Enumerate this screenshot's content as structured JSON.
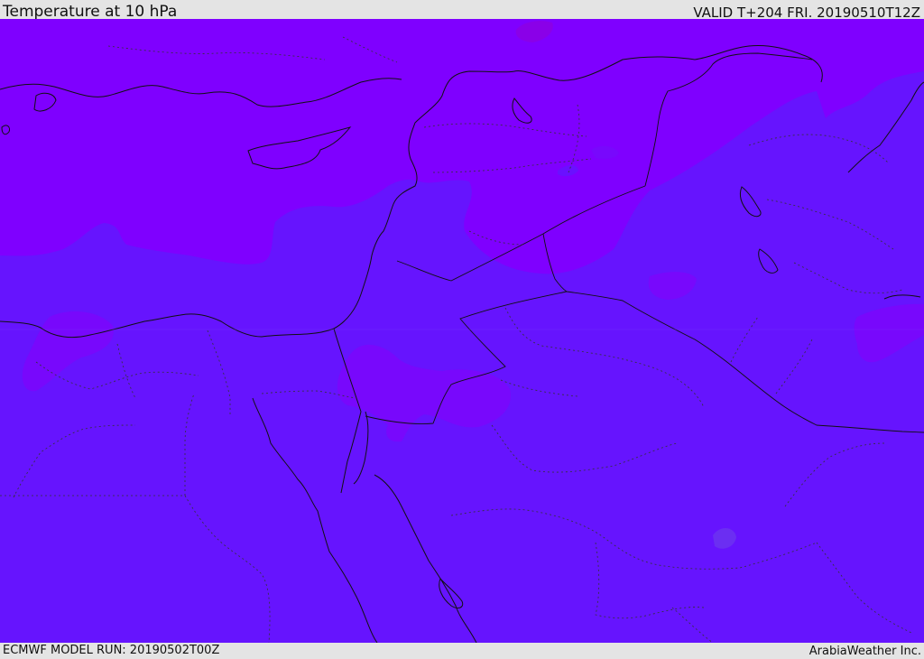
{
  "header": {
    "title": "Temperature at 10 hPa",
    "valid": "VALID T+204 FRI. 20190510T12Z"
  },
  "footer": {
    "model_run": "ECMWF MODEL RUN: 20190502T00Z",
    "credit": "ArabiaWeather Inc."
  },
  "map": {
    "colors": {
      "cold_band": "#7f00ff",
      "mid_band": "#6614fe",
      "warm_spot": "#6b2ef2",
      "coast": "#111111",
      "border": "#333333"
    }
  }
}
